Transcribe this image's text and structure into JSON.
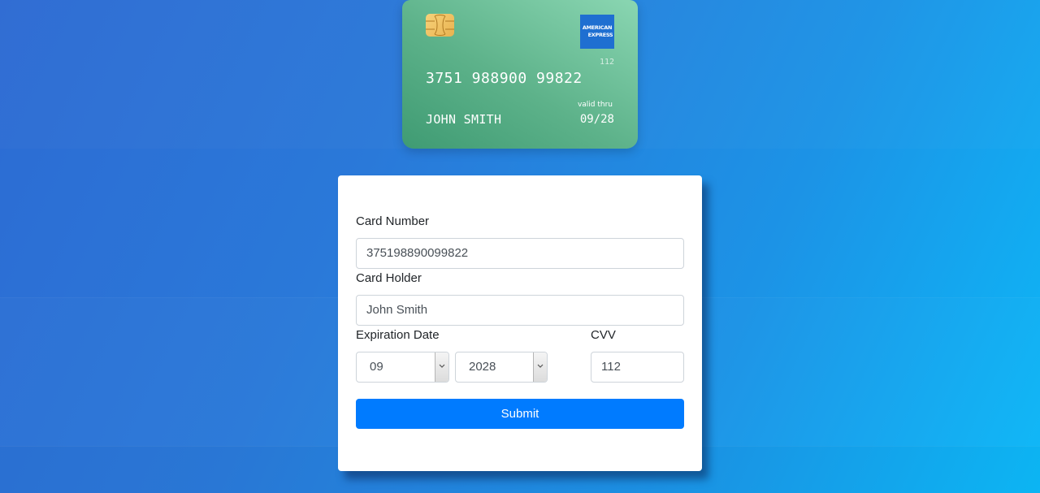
{
  "card_preview": {
    "number": "3751 988900 99822",
    "holder": "JOHN SMITH",
    "valid_thru_label": "valid thru",
    "expiry": "09/28",
    "cvv": "112",
    "brand_line1": "AMERICAN",
    "brand_line2": "EXPRESS",
    "brand_icon": "amex-logo",
    "chip_icon": "chip-icon",
    "color_start": "#3f9b73",
    "color_end": "#8ad6b2"
  },
  "form": {
    "card_number_label": "Card Number",
    "card_number_value": "375198890099822",
    "card_holder_label": "Card Holder",
    "card_holder_value": "John Smith",
    "expiration_label": "Expiration Date",
    "month_value": "09",
    "year_value": "2028",
    "cvv_label": "CVV",
    "cvv_value": "112",
    "submit_label": "Submit",
    "submit_color": "#007bff"
  }
}
